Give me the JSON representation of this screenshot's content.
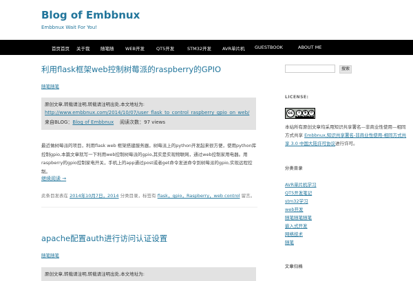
{
  "site": {
    "title": "Blog of Embbnux",
    "description": "Embbnux Wait For You!"
  },
  "nav": {
    "items": [
      "首页首页",
      "关于我",
      "随笔随",
      "WEB开发",
      "QT5开发",
      "STM32开发",
      "AVR单片机",
      "GUESTBOOK",
      "ABOUT ME"
    ]
  },
  "posts": [
    {
      "title": "利用flask框架web控制树莓派的raspberry的GPIO",
      "category": "随笔随笔",
      "info_line": "原创文章,转载请注明,转载请注明出处,本文地址为:",
      "info_url": "http://www.embbnux.com/2014/10/07/user_flask_to_control_raspberry_gpio_on_web/",
      "info_prefix": "来自BLOG：",
      "info_blog_link": "Blog of Embbnux",
      "info_views": "阅读次数：97 views",
      "excerpt": "最近做树莓派的项目，利用flask web 框架搭建服务器，树莓派上的python开发起来很方便，使用python库控制gpio,本篇文章就写一下利用web控制树莓派的gpio,其实是实现物联网，通过web控制家用电器。用raspberry的gpio控制家电开关，手机上的app通过post或者get命令发送命令到树莓派的gpio,实现远程控制。",
      "read_more": "继续阅读 →",
      "meta_prefix": "此条目发表在 ",
      "meta_date": "2014年10月7日，2014",
      "meta_mid": " 分类目录，标签有 ",
      "meta_tags": "flask，gpio，Raspberry，web control",
      "meta_suffix": " 留言。"
    },
    {
      "title": "apache配置auth进行访问认证设置",
      "category": "随笔随笔",
      "info_line": "原创文章,转载请注明,转载请注明出处,本文地址为:"
    }
  ],
  "sidebar": {
    "search_button": "搜索",
    "license_title": "LICENSE:",
    "license_badge": "BY NC SA",
    "license_text": "本站所有原创文章均采用知识共享署名—非商业性使用—相同方式共享 ",
    "license_link": "Embbnux,知识共享署名-非商业性使用-相同方式共享 3.0 中国大陆许可协议",
    "license_end": "进行许可。",
    "categories_title": "分类目录",
    "categories": [
      "AVR单片机学习",
      "QT5开发笔记",
      "stm32学习",
      "web开发",
      "随笔随笔随笔",
      "嵌入式开发",
      "网络技术",
      "随笔"
    ],
    "archives_title": "文章归档"
  },
  "colors": {
    "link": "#21759b",
    "nav_bg": "#000000",
    "box_bg": "#e2e2e2"
  }
}
